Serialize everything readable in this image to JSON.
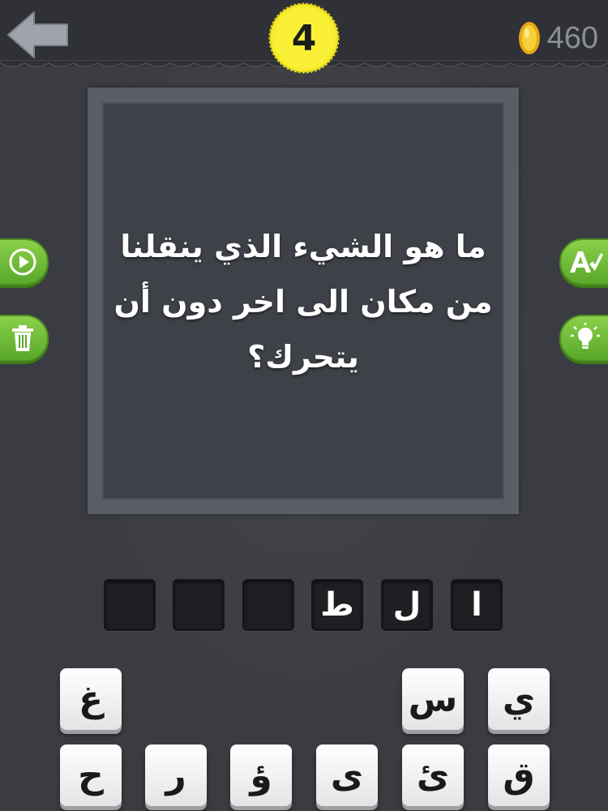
{
  "header": {
    "level": "4",
    "coins": "460"
  },
  "question": {
    "text": "ما هو الشيء الذي ينقلنا من مكان الى اخر دون أن يتحرك؟"
  },
  "side_buttons": [
    {
      "icon": "play-icon"
    },
    {
      "icon": "trash-icon"
    },
    {
      "icon": "letter-a-check-icon"
    },
    {
      "icon": "lightbulb-icon"
    }
  ],
  "answer_slots": [
    "ا",
    "ل",
    "ط",
    "",
    "",
    ""
  ],
  "letter_tiles": {
    "row1": [
      "ي",
      "س",
      "غ"
    ],
    "row2": [
      "ق",
      "ئ",
      "ى",
      "ؤ",
      "ر",
      "ح"
    ]
  },
  "colors": {
    "background": "#3a3c42",
    "accent_green": "#6cbc36",
    "badge_yellow": "#f6ec2a",
    "coin_gold": "#f2b81c"
  }
}
